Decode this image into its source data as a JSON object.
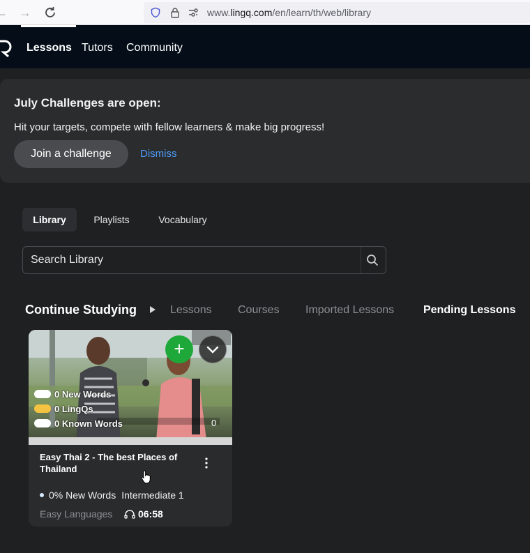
{
  "browser": {
    "url_prefix": "www.",
    "url_domain": "lingq.com",
    "url_path": "/en/learn/th/web/library"
  },
  "nav": {
    "lessons": "Lessons",
    "tutors": "Tutors",
    "community": "Community"
  },
  "banner": {
    "title": "July Challenges are open:",
    "text": "Hit your targets, compete with fellow learners & make big progress!",
    "join_label": "Join a challenge",
    "dismiss_label": "Dismiss"
  },
  "library_tabs": [
    {
      "label": "Library",
      "active": true
    },
    {
      "label": "Playlists",
      "active": false
    },
    {
      "label": "Vocabulary",
      "active": false
    }
  ],
  "search": {
    "placeholder": "Search Library"
  },
  "sections": {
    "title": "Continue Studying",
    "tabs": [
      "Lessons",
      "Courses",
      "Imported Lessons",
      "Pending Lessons"
    ],
    "active_tab": "Pending Lessons"
  },
  "card": {
    "stats": [
      {
        "label": "0 New Words",
        "pill_color": "#ffffff"
      },
      {
        "label": "0 LingQs",
        "pill_color": "#f5c342"
      },
      {
        "label": "0 Known Words",
        "pill_color": "#ffffff"
      }
    ],
    "count": "0",
    "title": "Easy Thai 2 - The best Places of Thailand",
    "new_words_pct": "0% New Words",
    "level": "Intermediate 1",
    "provider": "Easy Languages",
    "duration": "06:58"
  },
  "colors": {
    "accent_green": "#1fa83a",
    "link_blue": "#4d9cf8",
    "lingq_yellow": "#f5c342"
  }
}
